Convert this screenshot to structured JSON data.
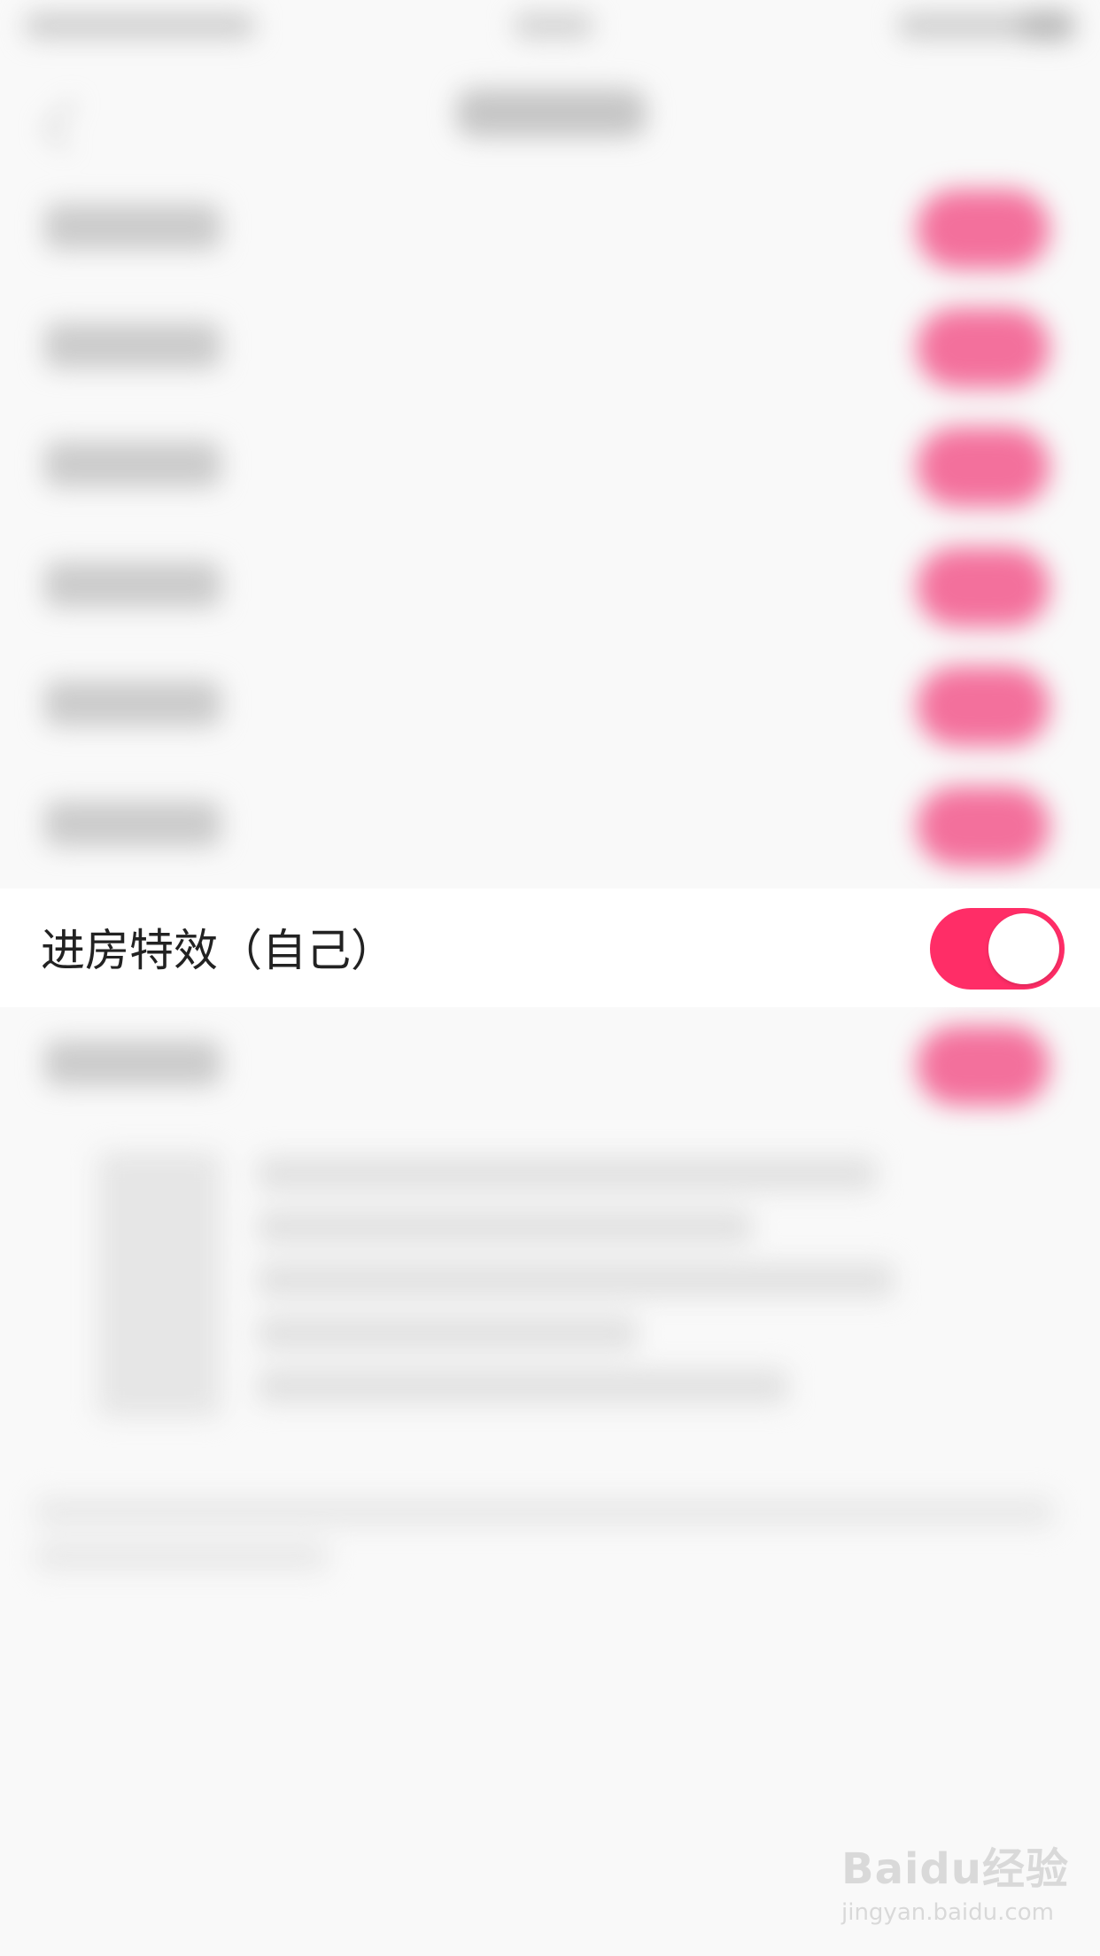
{
  "focus_setting": {
    "label": "进房特效（自己）",
    "enabled": true
  },
  "colors": {
    "toggle_on": "#ff2d67",
    "blurred_toggle": "#f3709c",
    "background": "#f9f9f9"
  },
  "watermark": {
    "brand": "Baidu经验",
    "url": "jingyan.baidu.com"
  }
}
